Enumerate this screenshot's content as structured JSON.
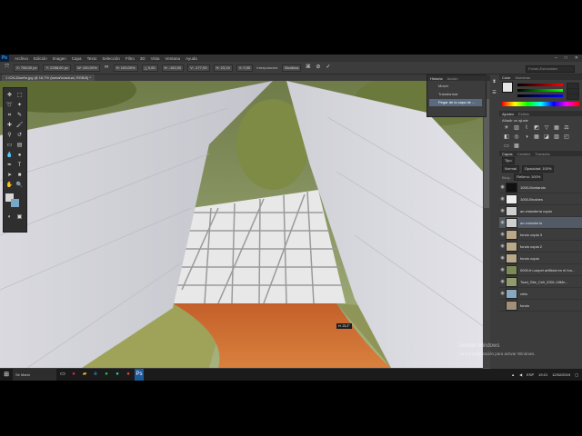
{
  "app": {
    "logo": "Ps"
  },
  "menu": [
    "Archivo",
    "Edición",
    "Imagen",
    "Capa",
    "Texto",
    "Selección",
    "Filtro",
    "3D",
    "Vista",
    "Ventana",
    "Ayuda"
  ],
  "window_controls": [
    "–",
    "□",
    "✕"
  ],
  "options_bar": {
    "x": "X: 758,00 px",
    "y": "Y: 2288,00 px",
    "w": "W: 100,00%",
    "h": "H: 100,00%",
    "angle": "△ 0,00",
    "hskew": "H: -162,00",
    "vskew": "V: -177,00",
    "extra1": "H: 23,19",
    "extra2": "V: 0,00",
    "interp_label": "Interpolación:",
    "interp_value": "Bicúbica",
    "search": "Fondo-Esenciales"
  },
  "document_tab": "1 ICN-Diseño.jpg @ 16,7% (tamaño/actual, RGB/8) *",
  "status": {
    "zoom": "16,67%",
    "doc": "Doc: 148,0M/3,47G"
  },
  "canvas_readout": "H: 23,2°",
  "history_panel": {
    "tabs": [
      "Historia",
      "Acción"
    ],
    "items": [
      {
        "label": "Mover",
        "selected": false
      },
      {
        "label": "Transformar",
        "selected": false
      },
      {
        "label": "Pegar de la capa de ...",
        "selected": true
      }
    ]
  },
  "color_panel": {
    "tabs": [
      "Color",
      "Muestras"
    ]
  },
  "adjustments_panel": {
    "tabs": [
      "Ajustes",
      "Estilos"
    ],
    "hint": "Añadir un ajuste"
  },
  "layers_panel": {
    "tabs": [
      "Capas",
      "Canales",
      "Trazados"
    ],
    "kind": "Tipo",
    "blend": "Normal",
    "opacity": "Opacidad: 100%",
    "lock": "Bloq.:",
    "fill": "Relleno: 100%",
    "layers": [
      {
        "name": "1000-Montando",
        "selected": false,
        "visible": true
      },
      {
        "name": "1000-Brushes",
        "selected": false,
        "visible": true
      },
      {
        "name": "arr-estantería copia",
        "selected": false,
        "visible": true
      },
      {
        "name": "arr-estantería",
        "selected": true,
        "visible": true
      },
      {
        "name": "fondo copia 3",
        "selected": false,
        "visible": true
      },
      {
        "name": "fondo copia 2",
        "selected": false,
        "visible": true
      },
      {
        "name": "fondo copia",
        "selected": false,
        "visible": true
      },
      {
        "name": "0000-fn carpet artificial en el fon...",
        "selected": false,
        "visible": true
      },
      {
        "name": "Toad_Site_Cell_0301-18Mn...",
        "selected": false,
        "visible": true
      },
      {
        "name": "cielo",
        "selected": false,
        "visible": true
      },
      {
        "name": "fondo",
        "selected": false,
        "visible": false
      }
    ]
  },
  "watermark": {
    "title": "Activar Windows",
    "subtitle": "Ve a Configuración para activar Windows."
  },
  "taskbar": {
    "search": "Sé Marín",
    "time": "19:21",
    "date": "12/02/2019",
    "lang": "ESP"
  },
  "icons": {
    "move": "move-icon",
    "marquee": "marquee-icon",
    "lasso": "lasso-icon",
    "brush": "brush-icon",
    "eye": "eye-icon",
    "search": "search-icon"
  }
}
